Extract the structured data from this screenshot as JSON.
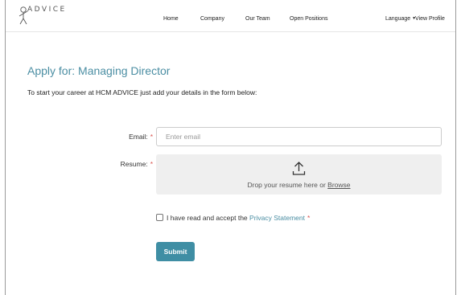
{
  "nav": {
    "logo_text": "ADVICE",
    "home": "Home",
    "company": "Company",
    "our_team": "Our Team",
    "open_positions": "Open Positions",
    "language": "Language",
    "view_profile": "View Profile"
  },
  "page": {
    "title": "Apply for: Managing Director",
    "intro": "To start your career at HCM ADVICE just add your details in the form below:"
  },
  "form": {
    "email_label": "Email:",
    "email_placeholder": "Enter email",
    "email_value": "",
    "resume_label": "Resume:",
    "required_mark": "*",
    "dropzone_text": "Drop your resume here or ",
    "browse_label": "Browse",
    "consent_text": "I have read and accept the ",
    "privacy_label": "Privacy Statement",
    "submit_label": "Submit"
  },
  "colors": {
    "accent": "#4b8ea3",
    "submit_bg": "#3f8ea4",
    "required": "#d9534f"
  },
  "icons": {
    "logo": "person-logo-icon",
    "upload": "upload-icon",
    "language_caret": "caret-down-icon"
  }
}
